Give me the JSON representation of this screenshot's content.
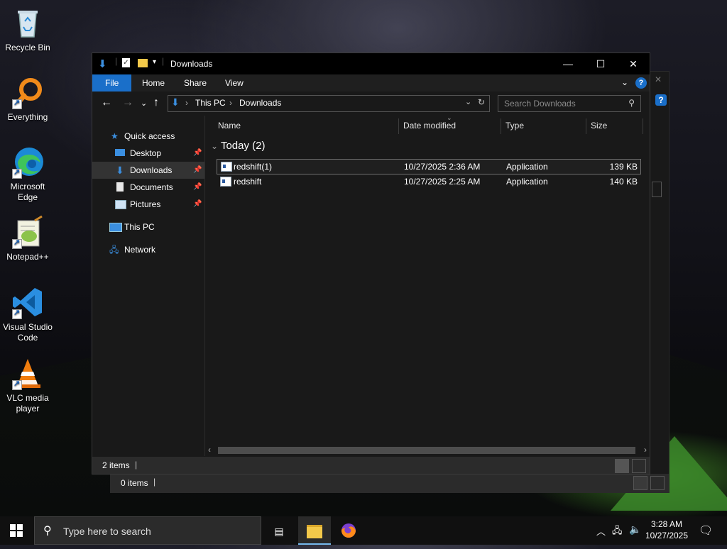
{
  "desktop": {
    "icons": [
      {
        "label": "Recycle Bin",
        "icon": "recycle-bin-icon"
      },
      {
        "label": "Everything",
        "icon": "everything-search-icon"
      },
      {
        "label": "Microsoft Edge",
        "icon": "edge-icon"
      },
      {
        "label": "Notepad++",
        "icon": "notepadpp-icon"
      },
      {
        "label": "Visual Studio Code",
        "icon": "vscode-icon"
      },
      {
        "label": "VLC media player",
        "icon": "vlc-icon"
      }
    ]
  },
  "background_window": {
    "status_text": "0 items"
  },
  "explorer": {
    "title": "Downloads",
    "ribbon_tabs": [
      "File",
      "Home",
      "Share",
      "View"
    ],
    "breadcrumb": [
      "This PC",
      "Downloads"
    ],
    "search_placeholder": "Search Downloads",
    "nav": {
      "quick_access": "Quick access",
      "items": [
        "Desktop",
        "Downloads",
        "Documents",
        "Pictures"
      ],
      "this_pc": "This PC",
      "network": "Network"
    },
    "columns": [
      "Name",
      "Date modified",
      "Type",
      "Size"
    ],
    "group_label": "Today (2)",
    "files": [
      {
        "name": "redshift(1)",
        "date": "10/27/2025 2:36 AM",
        "type": "Application",
        "size": "139 KB"
      },
      {
        "name": "redshift",
        "date": "10/27/2025 2:25 AM",
        "type": "Application",
        "size": "140 KB"
      }
    ],
    "status_text": "2 items"
  },
  "taskbar": {
    "search_placeholder": "Type here to search",
    "time": "3:28 AM",
    "date": "10/27/2025"
  },
  "colors": {
    "accent": "#1a6fc9",
    "window_bg": "#191919",
    "titlebar": "#000000"
  }
}
